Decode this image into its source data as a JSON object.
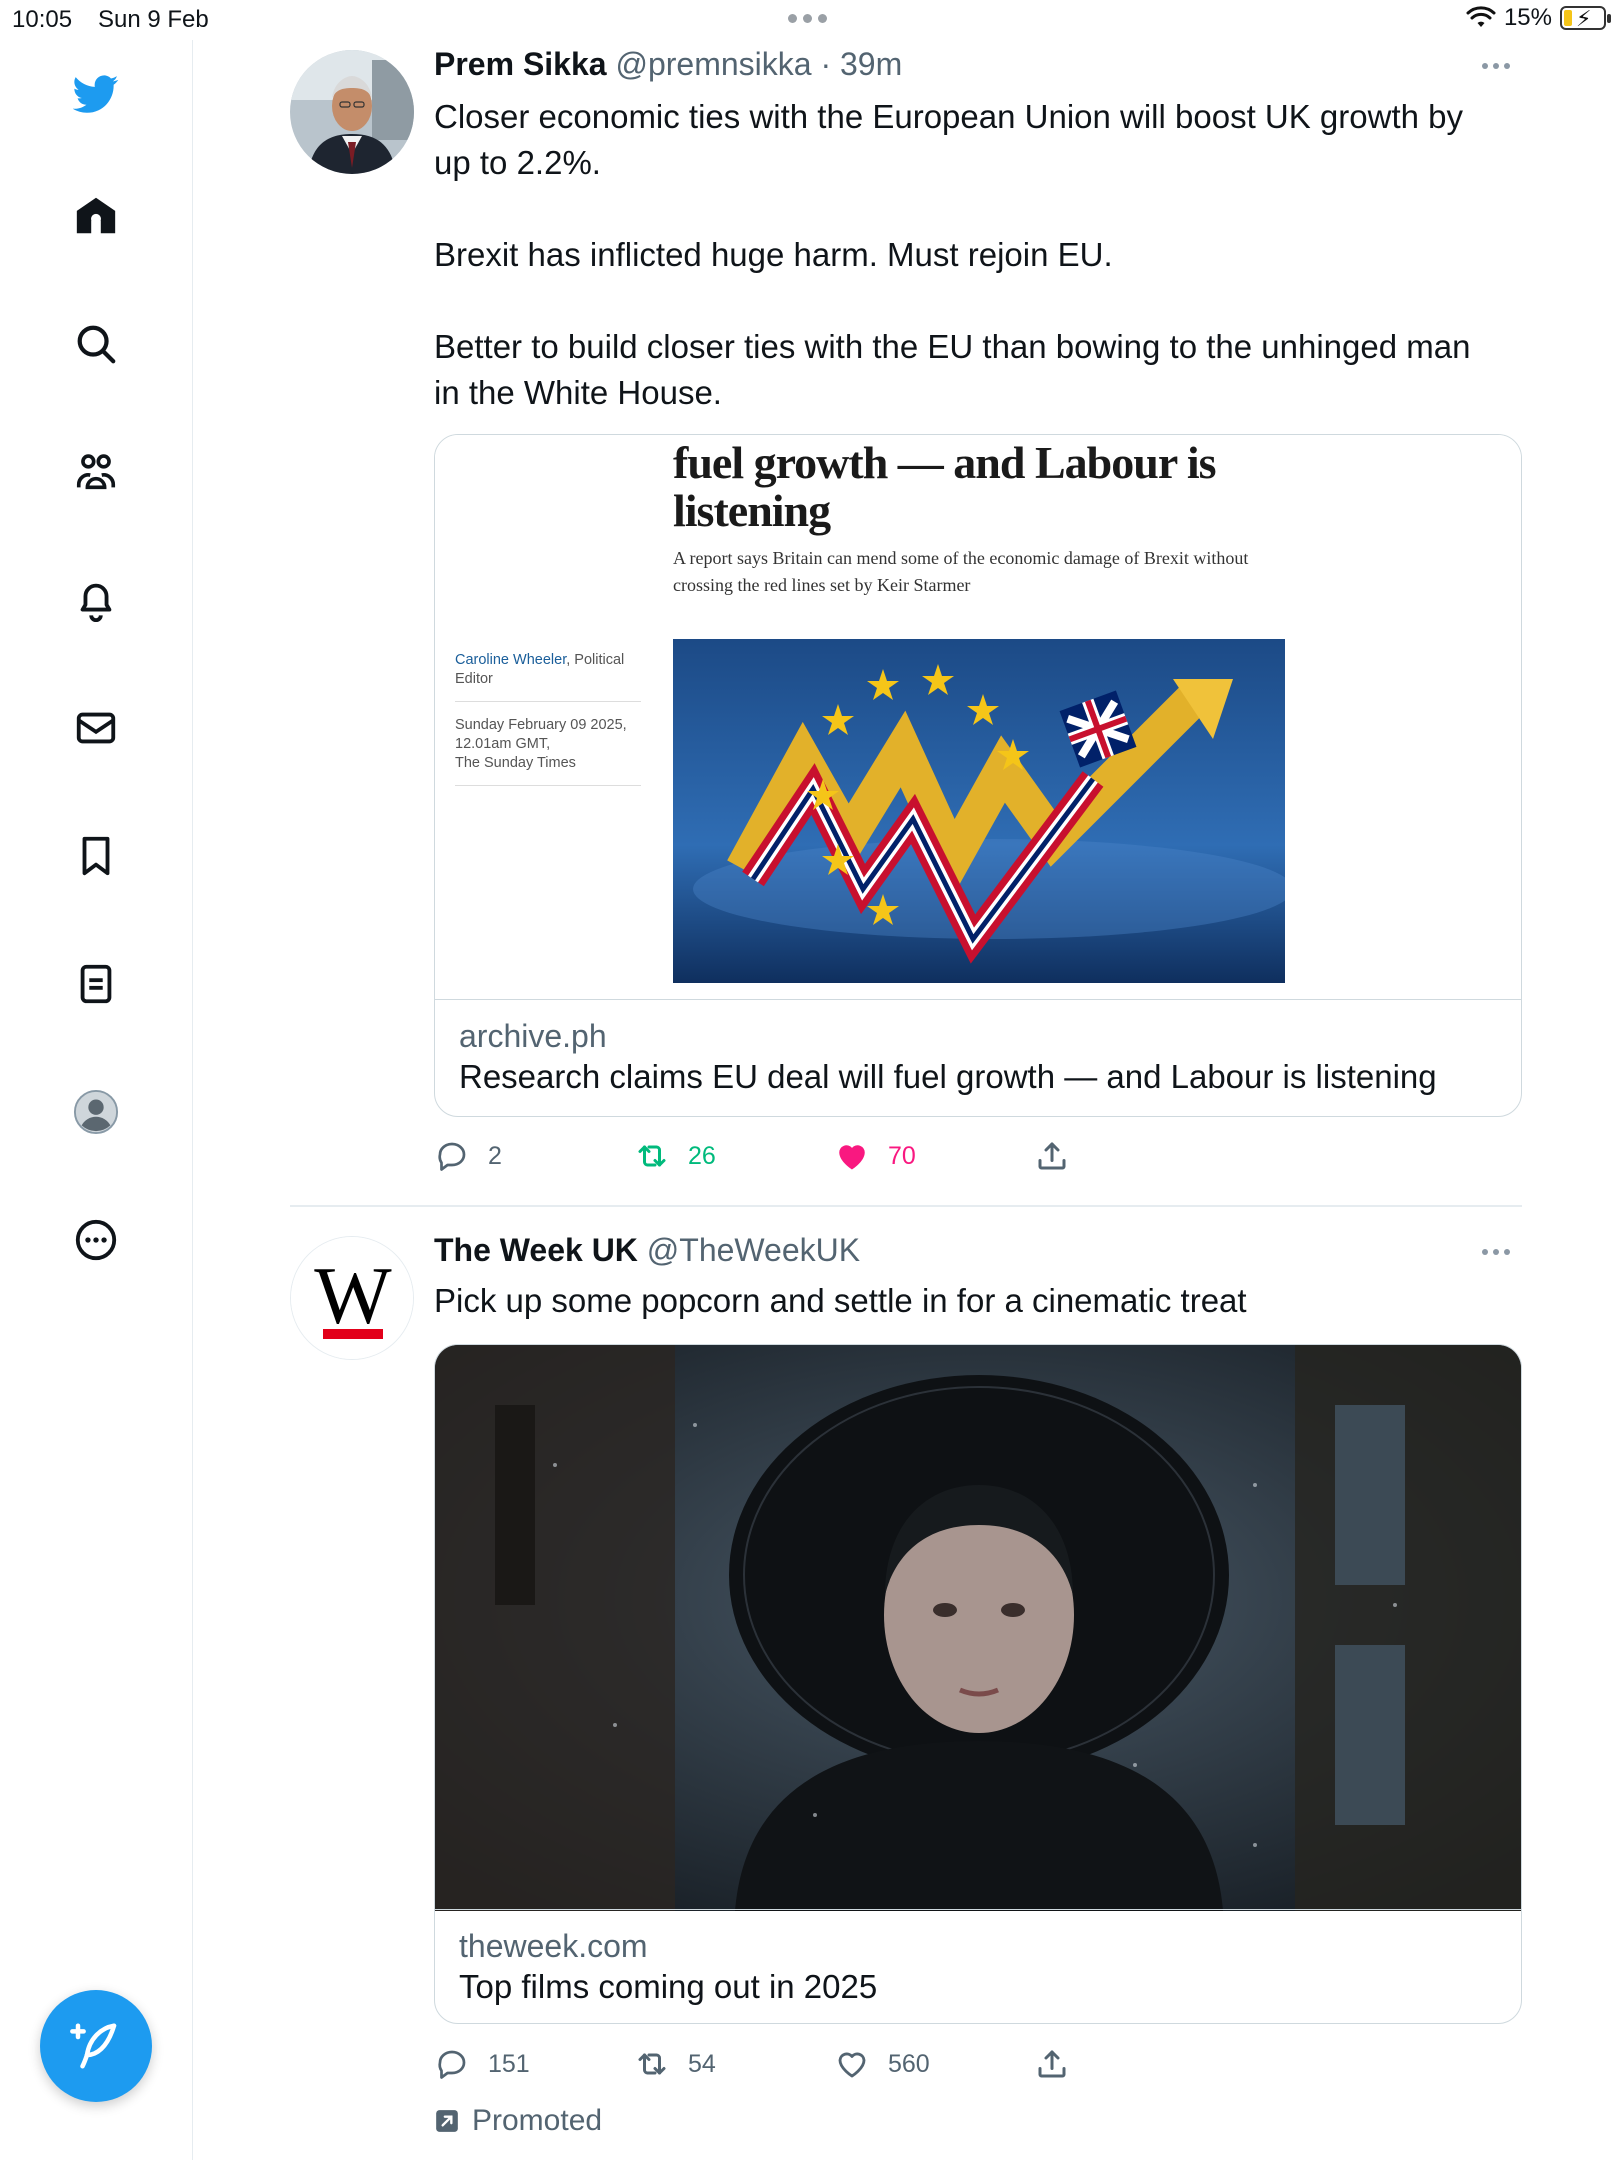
{
  "status_bar": {
    "time": "10:05",
    "date": "Sun 9 Feb",
    "battery": "15%"
  },
  "sidebar": {
    "items": [
      {
        "icon": "twitter-bird-icon"
      },
      {
        "icon": "home-icon"
      },
      {
        "icon": "search-icon"
      },
      {
        "icon": "communities-icon"
      },
      {
        "icon": "notifications-bell-icon"
      },
      {
        "icon": "messages-envelope-icon"
      },
      {
        "icon": "bookmark-icon"
      },
      {
        "icon": "lists-icon"
      },
      {
        "icon": "profile-avatar-icon"
      },
      {
        "icon": "more-circle-icon"
      }
    ],
    "compose_icon": "compose-feather-icon",
    "accent": "#1d9bf0"
  },
  "tweets": [
    {
      "name": "Prem Sikka",
      "handle": "@premnsikka",
      "time": "39m",
      "paragraphs": [
        "Closer economic ties with the European Union will boost UK growth by up to 2.2%.",
        "Brexit has inflicted huge harm. Must rejoin EU.",
        "Better to build closer ties with the EU than bowing to the unhinged man in the White House."
      ],
      "card": {
        "article_headline": "fuel growth — and Labour is listening",
        "article_subheading": "A report says Britain can mend some of the economic damage of Brexit without crossing the red lines set by Keir Starmer",
        "article_author": "Caroline Wheeler",
        "article_author_role": ", Political Editor",
        "article_date": "Sunday February 09 2025, 12.01am GMT,",
        "article_publication": "The Sunday Times",
        "domain": "archive.ph",
        "title": "Research claims EU deal will fuel growth — and Labour is listening"
      },
      "replies": "2",
      "retweets": "26",
      "likes": "70",
      "liked": true,
      "retweet_color": "#00ba7c",
      "like_color": "#f91880"
    },
    {
      "name": "The Week UK",
      "handle": "@TheWeekUK",
      "avatar_letter": "W",
      "paragraphs": [
        "Pick up some popcorn and settle in for a cinematic treat"
      ],
      "card": {
        "domain": "theweek.com",
        "title": "Top films coming out in 2025"
      },
      "replies": "151",
      "retweets": "54",
      "likes": "560",
      "promoted_label": "Promoted"
    }
  ]
}
